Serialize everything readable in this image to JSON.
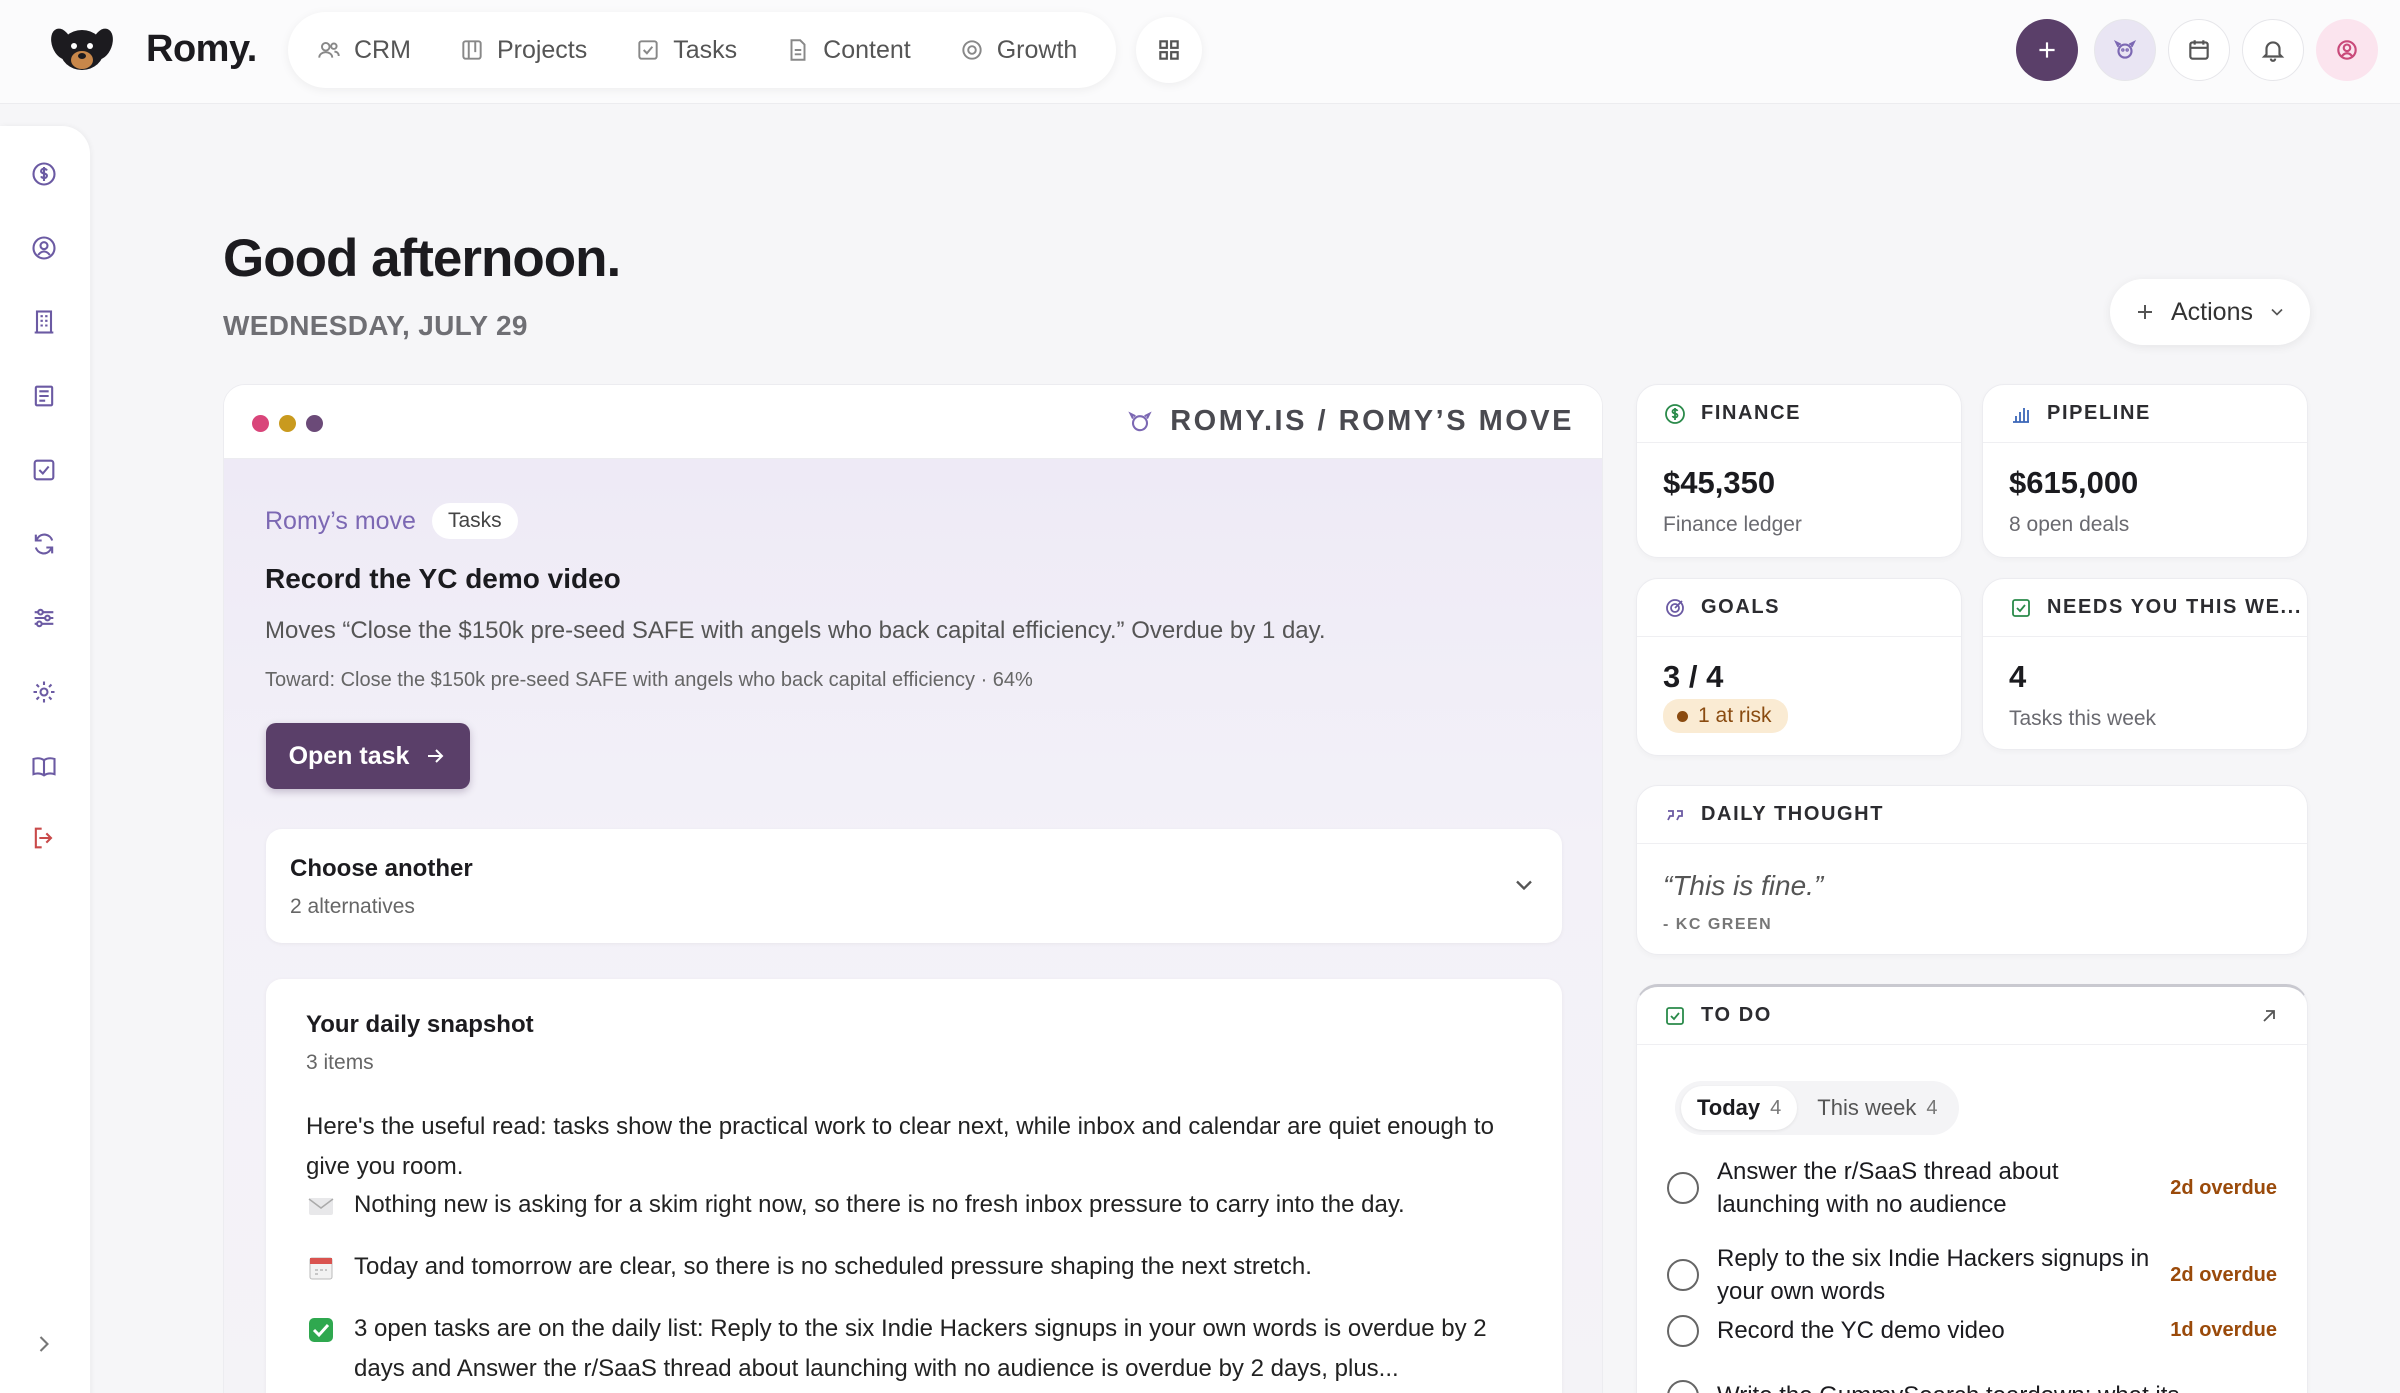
{
  "app": {
    "brand": "Romy.",
    "nav": [
      {
        "label": "CRM",
        "icon": "people-icon"
      },
      {
        "label": "Projects",
        "icon": "kanban-icon"
      },
      {
        "label": "Tasks",
        "icon": "checkbox-icon"
      },
      {
        "label": "Content",
        "icon": "document-icon"
      },
      {
        "label": "Growth",
        "icon": "target-icon"
      }
    ]
  },
  "header": {
    "greeting": "Good afternoon.",
    "date": "WEDNESDAY, JULY 29",
    "actions_label": "Actions"
  },
  "panel": {
    "path": "ROMY.IS / ROMY’S MOVE",
    "move_label": "Romy’s move",
    "move_chip": "Tasks",
    "task_title": "Record the YC demo video",
    "task_desc": "Moves “Close the $150k pre-seed SAFE with angels who back capital efficiency.” Overdue by 1 day.",
    "task_toward": "Toward: Close the $150k pre-seed SAFE with angels who back capital efficiency · 64%",
    "open_label": "Open task",
    "choose_title": "Choose another",
    "choose_sub": "2 alternatives",
    "snapshot_title": "Your daily snapshot",
    "snapshot_sub": "3 items",
    "snapshot_intro": "Here's the useful read: tasks show the practical work to clear next, while inbox and calendar are quiet enough to give you room.",
    "snapshot_items": [
      "Nothing new is asking for a skim right now, so there is no fresh inbox pressure to carry into the day.",
      "Today and tomorrow are clear, so there is no scheduled pressure shaping the next stretch.",
      "3 open tasks are on the daily list: Reply to the six Indie Hackers signups in your own words is overdue by 2 days and Answer the r/SaaS thread about launching with no audience is overdue by 2 days, plus..."
    ]
  },
  "cards": {
    "finance": {
      "title": "FINANCE",
      "value": "$45,350",
      "sub": "Finance ledger"
    },
    "pipeline": {
      "title": "PIPELINE",
      "value": "$615,000",
      "sub": "8 open deals"
    },
    "goals": {
      "title": "GOALS",
      "value": "3 / 4",
      "risk": "1 at risk"
    },
    "needs": {
      "title": "NEEDS YOU THIS WE...",
      "value": "4",
      "sub": "Tasks this week"
    },
    "thought": {
      "title": "DAILY THOUGHT",
      "quote": "“This is fine.”",
      "by": "- KC GREEN"
    },
    "todo": {
      "title": "TO DO",
      "tabs": [
        {
          "label": "Today",
          "count": "4"
        },
        {
          "label": "This week",
          "count": "4"
        }
      ],
      "items": [
        {
          "text": "Answer the r/SaaS thread about launching with no audience",
          "status": "2d overdue"
        },
        {
          "text": "Reply to the six Indie Hackers signups in your own words",
          "status": "2d overdue"
        },
        {
          "text": "Record the YC demo video",
          "status": "1d overdue"
        },
        {
          "text": "Write the GummySearch teardown: what its...",
          "status": ""
        }
      ]
    }
  },
  "colors": {
    "accent": "#5a3f69",
    "move_label": "#7c68b3",
    "overdue": "#9a4a0a",
    "dot1": "#d9457a",
    "dot2": "#c99a1e",
    "dot3": "#6b4a78"
  }
}
